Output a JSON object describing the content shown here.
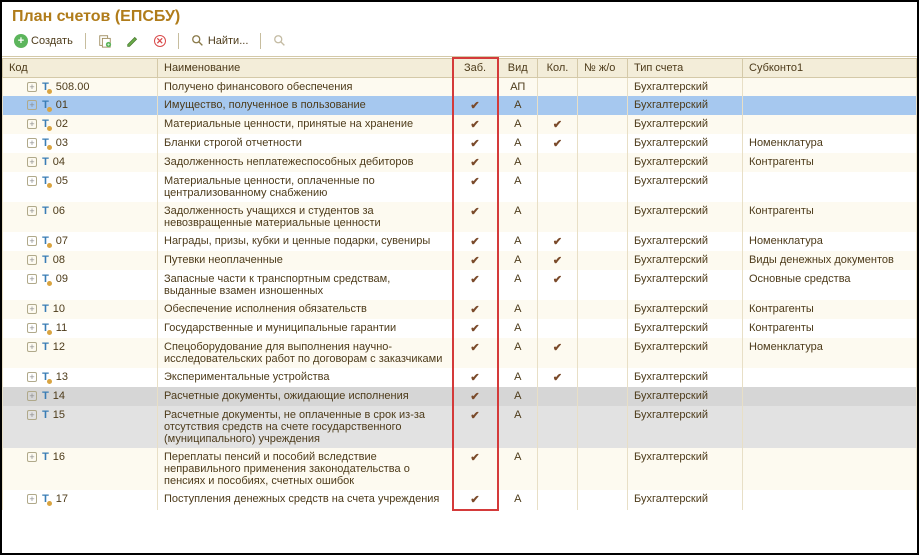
{
  "title": "План счетов (ЕПСБУ)",
  "toolbar": {
    "create": "Создать",
    "find": "Найти..."
  },
  "columns": {
    "code": "Код",
    "name": "Наименование",
    "zab": "Заб.",
    "vid": "Вид",
    "kol": "Кол.",
    "zho": "№ ж/о",
    "type": "Тип счета",
    "sub": "Субконто1"
  },
  "rows": [
    {
      "code": "508.00",
      "dot": true,
      "name": "Получено финансового обеспечения",
      "zab": "",
      "vid": "АП",
      "kol": "",
      "type": "Бухгалтерский",
      "sub": "",
      "cls": "odd"
    },
    {
      "code": "01",
      "dot": true,
      "name": "Имущество, полученное в пользование",
      "zab": "✔",
      "vid": "А",
      "kol": "",
      "type": "Бухгалтерский",
      "sub": "",
      "cls": "sel"
    },
    {
      "code": "02",
      "dot": true,
      "name": "Материальные ценности, принятые на хранение",
      "zab": "✔",
      "vid": "А",
      "kol": "✔",
      "type": "Бухгалтерский",
      "sub": "",
      "cls": "odd"
    },
    {
      "code": "03",
      "dot": true,
      "name": "Бланки строгой отчетности",
      "zab": "✔",
      "vid": "А",
      "kol": "✔",
      "type": "Бухгалтерский",
      "sub": "Номенклатура",
      "cls": "even"
    },
    {
      "code": "04",
      "dot": false,
      "name": "Задолженность неплатежеспособных дебиторов",
      "zab": "✔",
      "vid": "А",
      "kol": "",
      "type": "Бухгалтерский",
      "sub": "Контрагенты",
      "cls": "odd"
    },
    {
      "code": "05",
      "dot": true,
      "name": "Материальные ценности, оплаченные по централизованному снабжению",
      "zab": "✔",
      "vid": "А",
      "kol": "",
      "type": "Бухгалтерский",
      "sub": "",
      "cls": "even"
    },
    {
      "code": "06",
      "dot": false,
      "name": "Задолженность учащихся и студентов за невозвращенные материальные ценности",
      "zab": "✔",
      "vid": "А",
      "kol": "",
      "type": "Бухгалтерский",
      "sub": "Контрагенты",
      "cls": "odd"
    },
    {
      "code": "07",
      "dot": true,
      "name": "Награды, призы, кубки и ценные подарки, сувениры",
      "zab": "✔",
      "vid": "А",
      "kol": "✔",
      "type": "Бухгалтерский",
      "sub": "Номенклатура",
      "cls": "even"
    },
    {
      "code": "08",
      "dot": false,
      "name": "Путевки неоплаченные",
      "zab": "✔",
      "vid": "А",
      "kol": "✔",
      "type": "Бухгалтерский",
      "sub": "Виды денежных документов",
      "cls": "odd"
    },
    {
      "code": "09",
      "dot": true,
      "name": "Запасные части к транспортным средствам, выданные взамен изношенных",
      "zab": "✔",
      "vid": "А",
      "kol": "✔",
      "type": "Бухгалтерский",
      "sub": "Основные средства",
      "cls": "even"
    },
    {
      "code": "10",
      "dot": false,
      "name": "Обеспечение исполнения обязательств",
      "zab": "✔",
      "vid": "А",
      "kol": "",
      "type": "Бухгалтерский",
      "sub": "Контрагенты",
      "cls": "odd"
    },
    {
      "code": "11",
      "dot": true,
      "name": "Государственные и муниципальные гарантии",
      "zab": "✔",
      "vid": "А",
      "kol": "",
      "type": "Бухгалтерский",
      "sub": "Контрагенты",
      "cls": "even"
    },
    {
      "code": "12",
      "dot": false,
      "name": "Спецоборудование для выполнения научно-исследовательских работ по договорам с заказчиками",
      "zab": "✔",
      "vid": "А",
      "kol": "✔",
      "type": "Бухгалтерский",
      "sub": "Номенклатура",
      "cls": "odd"
    },
    {
      "code": "13",
      "dot": true,
      "name": "Экспериментальные устройства",
      "zab": "✔",
      "vid": "А",
      "kol": "✔",
      "type": "Бухгалтерский",
      "sub": "",
      "cls": "even"
    },
    {
      "code": "14",
      "dot": false,
      "name": "Расчетные документы, ожидающие исполнения",
      "zab": "✔",
      "vid": "А",
      "kol": "",
      "type": "Бухгалтерский",
      "sub": "",
      "cls": "grey-odd"
    },
    {
      "code": "15",
      "dot": false,
      "name": "Расчетные документы, не оплаченные в срок из-за отсутствия средств на счете государственного (муниципального) учреждения",
      "zab": "✔",
      "vid": "А",
      "kol": "",
      "type": "Бухгалтерский",
      "sub": "",
      "cls": "grey-even"
    },
    {
      "code": "16",
      "dot": false,
      "name": "Переплаты пенсий и пособий вследствие неправильного применения законодательства о пенсиях и пособиях, счетных ошибок",
      "zab": "✔",
      "vid": "А",
      "kol": "",
      "type": "Бухгалтерский",
      "sub": "",
      "cls": "odd"
    },
    {
      "code": "17",
      "dot": true,
      "name": "Поступления денежных средств на счета учреждения",
      "zab": "✔",
      "vid": "А",
      "kol": "",
      "type": "Бухгалтерский",
      "sub": "",
      "cls": "even"
    }
  ]
}
